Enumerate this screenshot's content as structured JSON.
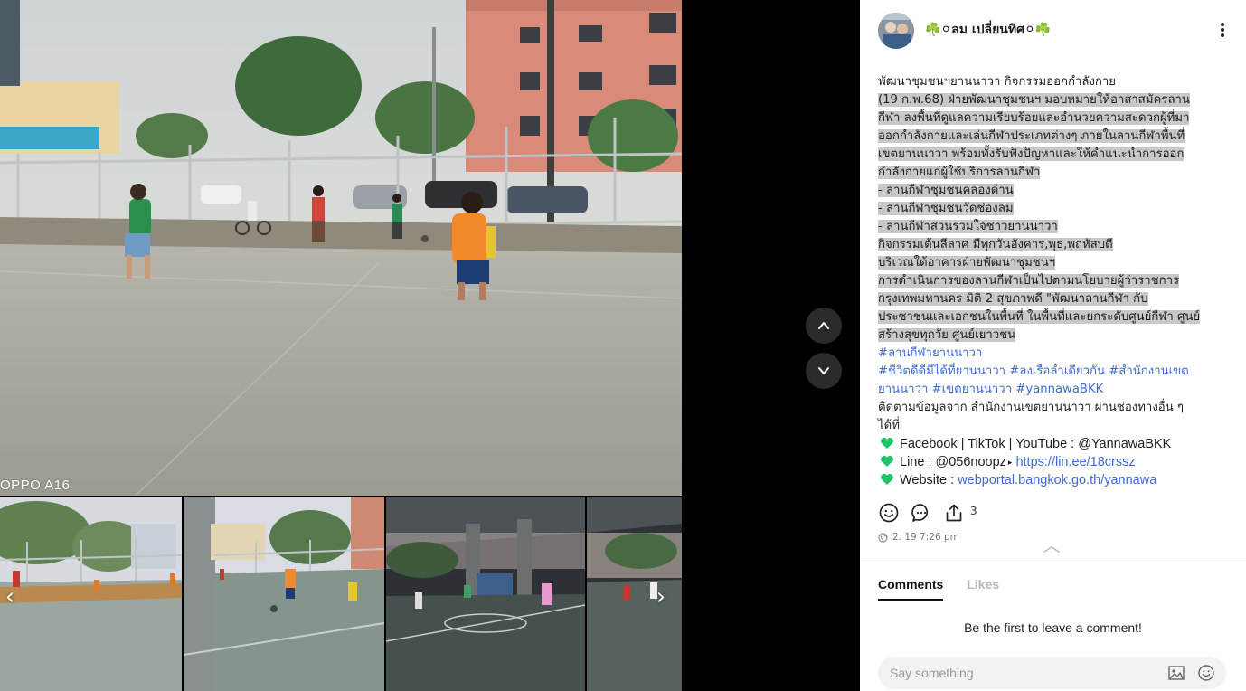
{
  "viewer": {
    "watermark": "OPPO A16",
    "prev_arrow": "‹",
    "next_arrow": "›",
    "nav_up_icon": "chevron-up-icon",
    "nav_down_icon": "chevron-down-icon"
  },
  "post": {
    "author": "☘️⚪ลม เปลี่ยนทิศ⚪☘️",
    "lines": [
      "พัฒนาชุมชนฯยานนาวา กิจกรรมออกกำลังกาย",
      " (19 ก.พ.68)  ฝ่ายพัฒนาชุมชนฯ มอบหมายให้อาสาสมัครลาน",
      "กีฬา ลงพื้นที่ดูแลความเรียบร้อยและอำนวยความสะดวกผู้ที่มา",
      "ออกกำลังกายและเล่นกีฬาประเภทต่างๆ ภายในลานกีฬาพื้นที่",
      "เขตยานนาวา พร้อมทั้งรับฟังปัญหาและให้คำแนะนำการออก",
      "กำลังกายแก่ผู้ใช้บริการลานกีฬา",
      "- ลานกีฬาชุมชนคลองด่าน",
      "- ลานกีฬาชุมชนวัดช่องลม",
      "- ลานกีฬาสวนรวมใจชาวยานนาวา",
      "กิจกรรมเต้นลีลาศ มีทุกวันอังคาร,พุธ,พฤหัสบดี",
      "บริเวณใต้อาคารฝ่ายพัฒนาชุมชนฯ",
      "   การดำเนินการของลานกีฬาเป็นไปตามนโยบายผู้ว่าราชการ",
      "กรุงเทพมหานคร  มิติ 2 สุขภาพดี  \"พัฒนาลานกีฬา กับ",
      "ประชาชนและเอกชนในพื้นที่ ในพื้นที่และยกระดับศูนย์กีฬา ศูนย์",
      "สร้างสุขทุกวัย ศูนย์เยาวชน"
    ],
    "hashtags": {
      "line1": "#ลานกีฬายานนาวา",
      "line2a": "#ชีวิตดีดีมีได้ที่ยานนาวา",
      "line2b": "#ลงเรือลำเดียวกัน",
      "line2c": "#สำนักงานเขต",
      "line3a": "ยานนาวา",
      "line3b": "#เขตยานนาวา",
      "line3c": "#yannawaBKK"
    },
    "follow_line1": "ติดตามข้อมูลจาก สำนักงานเขตยานนาวา ผ่านช่องทางอื่น ๆ",
    "follow_line2": "ได้ที่",
    "contacts": {
      "social": "Facebook | TikTok | YouTube : @YannawaBKK",
      "line_label": "Line : @056noopz",
      "line_caret": "▸",
      "line_url": "https://lin.ee/18crssz",
      "web_label": "Website : ",
      "web_url": "webportal.bangkok.go.th/yannawa"
    },
    "heart_color": "#1fc36a",
    "share_count": "3",
    "timestamp": "2. 19 7:26 pm"
  },
  "comments": {
    "tabs": [
      "Comments",
      "Likes"
    ],
    "empty": "Be the first to leave a comment!",
    "placeholder": "Say something"
  },
  "colors": {
    "accent": "#3f6ad8",
    "highlight": "#c8c8c8",
    "nav_button": "#2b2b2b"
  }
}
